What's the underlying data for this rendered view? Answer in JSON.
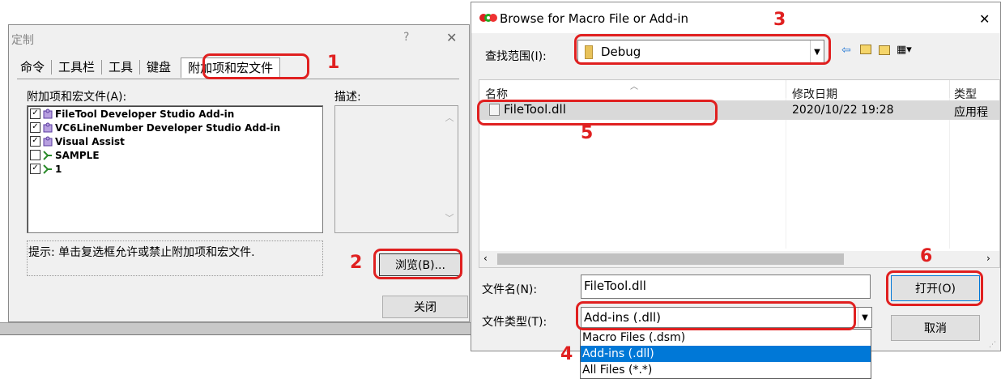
{
  "customize_dialog": {
    "title": "定制",
    "help_glyph": "?",
    "close_glyph": "✕",
    "tabs": [
      "命令",
      "工具栏",
      "工具",
      "键盘",
      "附加项和宏文件"
    ],
    "addins_label": "附加项和宏文件(A):",
    "description_label": "描述:",
    "addins": [
      {
        "name": "FileTool Developer Studio Add-in",
        "checked": true,
        "icon": "puzzle-icon"
      },
      {
        "name": "VC6LineNumber Developer Studio Add-in",
        "checked": true,
        "icon": "puzzle-icon"
      },
      {
        "name": "Visual Assist",
        "checked": true,
        "icon": "puzzle-icon"
      },
      {
        "name": "SAMPLE",
        "checked": false,
        "icon": "macro-icon"
      },
      {
        "name": "1",
        "checked": true,
        "icon": "macro-icon"
      }
    ],
    "hint": "提示: 单击复选框允许或禁止附加项和宏文件.",
    "browse_button": "浏览(B)...",
    "close_button": "关闭"
  },
  "browse_dialog": {
    "title": "Browse for Macro File or Add-in",
    "close_glyph": "✕",
    "look_in_label": "查找范围(I):",
    "look_in_value": "Debug",
    "columns": [
      "名称",
      "修改日期",
      "类型"
    ],
    "files": [
      {
        "name": "FileTool.dll",
        "modified": "2020/10/22 19:28",
        "type": "应用程"
      }
    ],
    "filename_label": "文件名(N):",
    "filename_value": "FileTool.dll",
    "filetype_label": "文件类型(T):",
    "filetype_value": "Add-ins (.dll)",
    "filetype_options": [
      "Macro Files (.dsm)",
      "Add-ins (.dll)",
      "All Files (*.*)"
    ],
    "open_button": "打开(O)",
    "cancel_button": "取消"
  },
  "annotations": [
    "1",
    "2",
    "3",
    "4",
    "5",
    "6"
  ],
  "colors": {
    "highlight": "#0078d7",
    "annotation": "#e02020",
    "selected_row": "#d9d9d9"
  }
}
